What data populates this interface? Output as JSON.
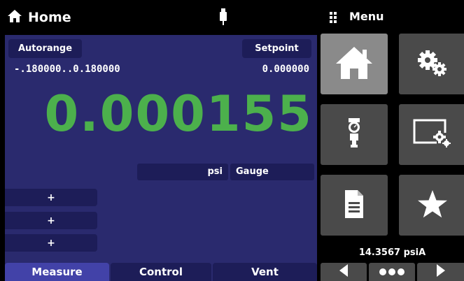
{
  "header": {
    "title": "Home",
    "menu_title": "Menu",
    "icons": [
      "home-icon",
      "usb-icon",
      "grip-icon"
    ]
  },
  "main": {
    "autorange_label": "Autorange",
    "range_value": "-.180000..0.180000",
    "setpoint_label": "Setpoint",
    "setpoint_value": "0.000000",
    "reading": "0.000155",
    "unit": "psi",
    "mode": "Gauge",
    "plus_buttons": [
      "+",
      "+",
      "+"
    ],
    "tabs": [
      {
        "label": "Measure",
        "active": true
      },
      {
        "label": "Control",
        "active": false
      },
      {
        "label": "Vent",
        "active": false
      }
    ]
  },
  "menu": {
    "tiles": [
      {
        "icon": "home-icon",
        "active": true
      },
      {
        "icon": "gears-icon",
        "active": false
      },
      {
        "icon": "sensor-icon",
        "active": false
      },
      {
        "icon": "display-settings-icon",
        "active": false
      },
      {
        "icon": "document-icon",
        "active": false
      },
      {
        "icon": "star-icon",
        "active": false
      }
    ],
    "barometer": "14.3567 psiA",
    "nav": [
      "left-arrow-icon",
      "page-dots-icon",
      "right-arrow-icon"
    ]
  },
  "colors": {
    "background": "#000000",
    "panel": "#2a2a6e",
    "panel_dark": "#1d1d58",
    "tab_active": "#4242a8",
    "reading": "#4cb04c",
    "tile": "#4a4a4a",
    "tile_active": "#8a8a8a"
  }
}
